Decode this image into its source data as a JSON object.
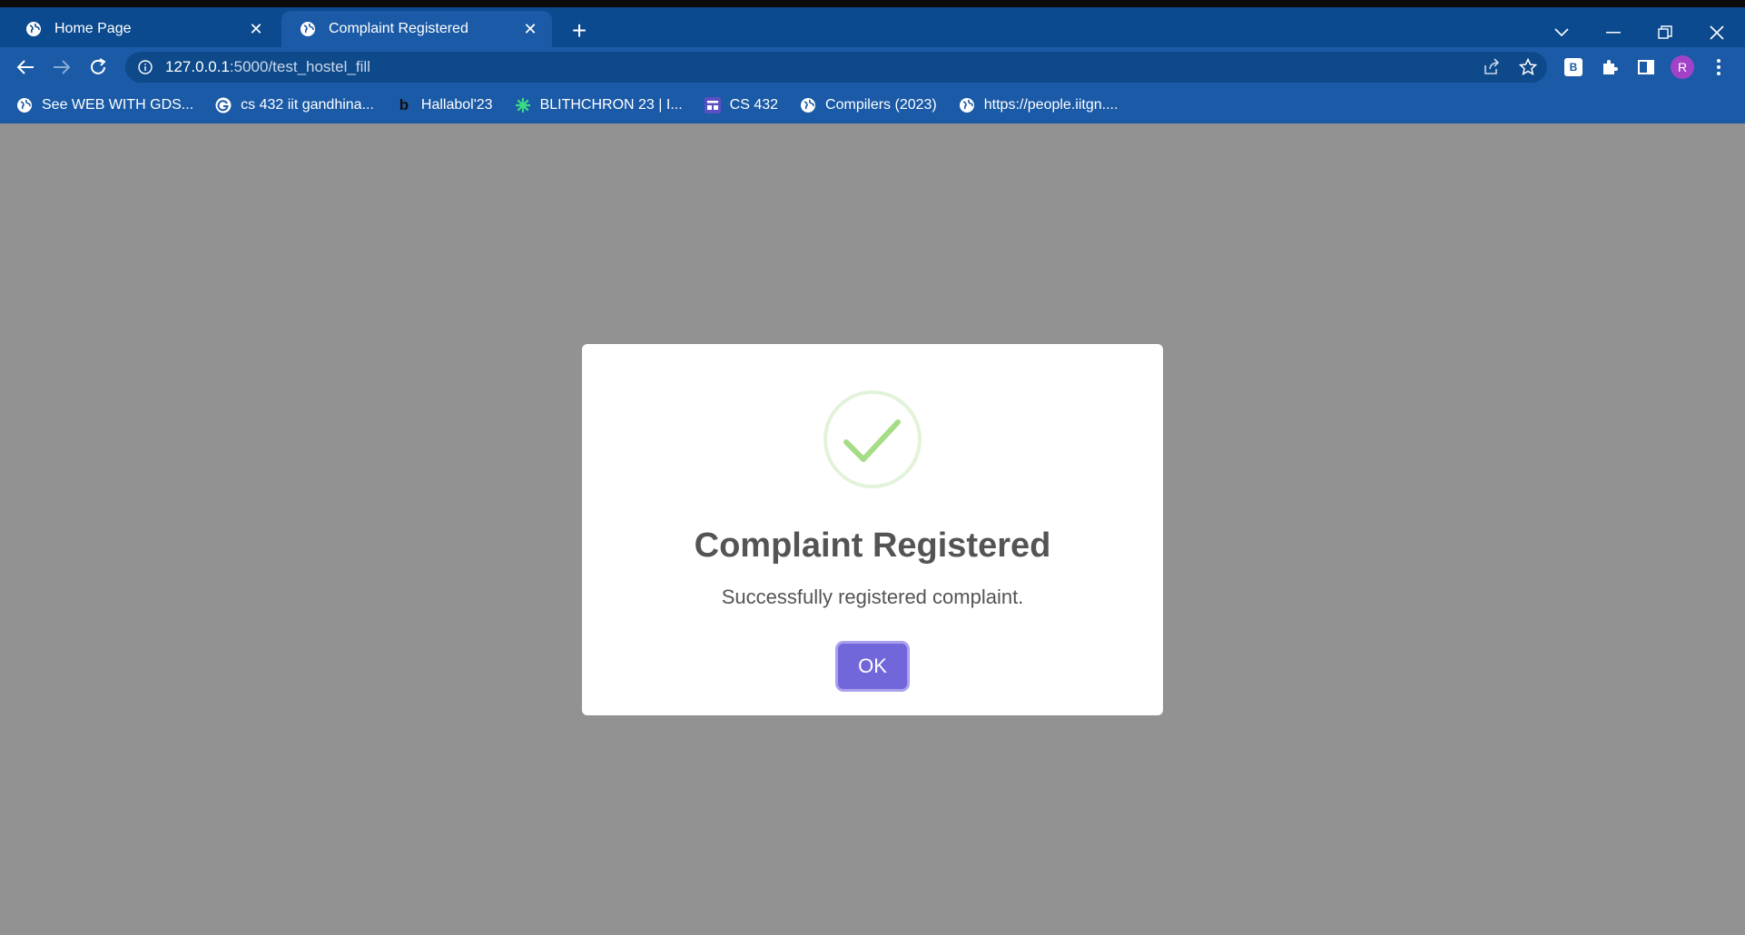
{
  "browser": {
    "tabs": [
      {
        "label": "Home Page",
        "active": false
      },
      {
        "label": "Complaint Registered",
        "active": true
      }
    ],
    "address": {
      "host": "127.0.0.1",
      "path": ":5000/test_hostel_fill"
    },
    "profile_initial": "R",
    "extension_badge": "B",
    "bookmarks": [
      {
        "label": "See WEB WITH GDS...",
        "icon": "globe-icon"
      },
      {
        "label": "cs 432 iit gandhina...",
        "icon": "google-icon"
      },
      {
        "label": "Hallabol'23",
        "icon": "b-logo-icon"
      },
      {
        "label": "BLITHCHRON 23 | I...",
        "icon": "asterisk-icon"
      },
      {
        "label": "CS 432",
        "icon": "board-icon"
      },
      {
        "label": "Compilers (2023)",
        "icon": "globe-icon"
      },
      {
        "label": "https://people.iitgn....",
        "icon": "globe-icon"
      }
    ]
  },
  "modal": {
    "title": "Complaint Registered",
    "text": "Successfully registered complaint.",
    "ok_label": "OK",
    "icon": "success-check-icon"
  },
  "colors": {
    "overlay": "#929292",
    "tabbar": "#0b4a8e",
    "toolbar": "#1a5aa6",
    "ok_button": "#7266db",
    "success": "#a5dc86"
  }
}
